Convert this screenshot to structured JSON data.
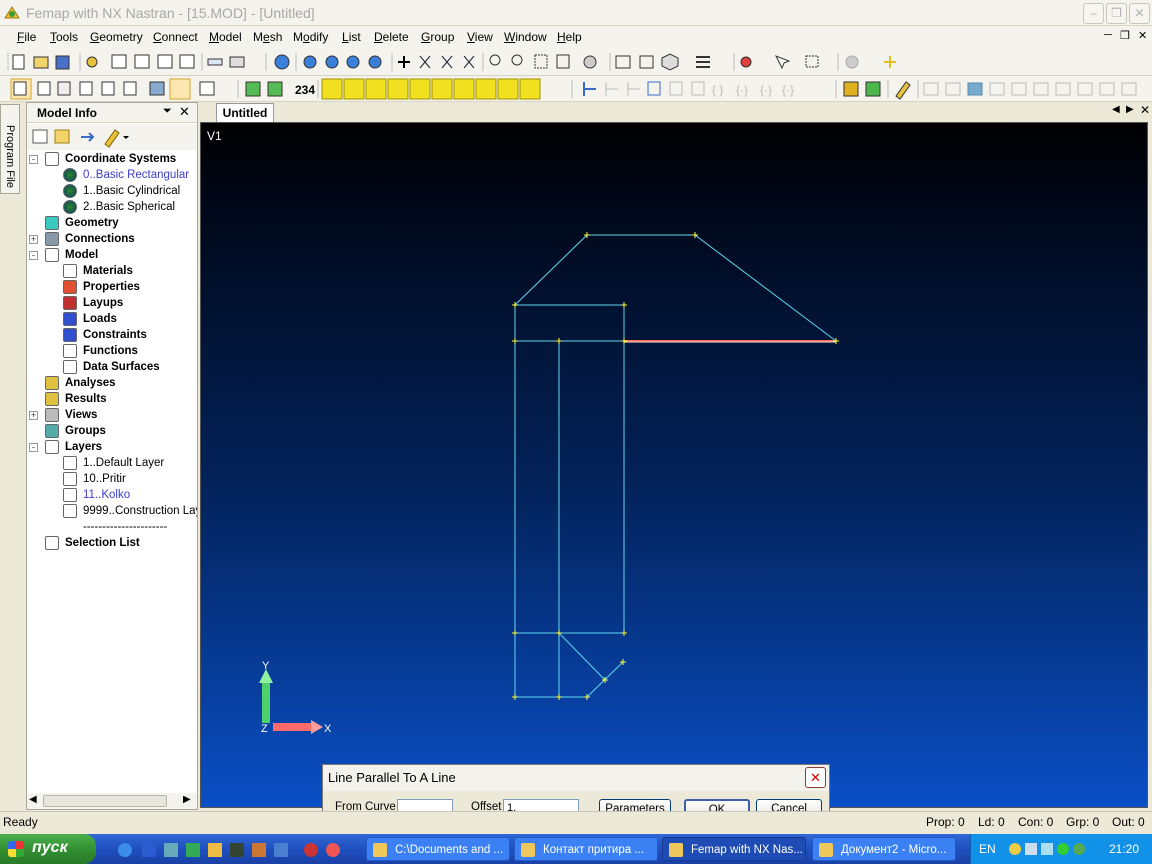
{
  "window": {
    "title": "Femap with NX Nastran - [15.MOD] - [Untitled]"
  },
  "menu": [
    {
      "pre": "",
      "u": "F",
      "post": "ile"
    },
    {
      "pre": "",
      "u": "T",
      "post": "ools"
    },
    {
      "pre": "",
      "u": "G",
      "post": "eometry"
    },
    {
      "pre": "",
      "u": "C",
      "post": "onnect"
    },
    {
      "pre": "",
      "u": "M",
      "post": "odel"
    },
    {
      "pre": "M",
      "u": "e",
      "post": "sh"
    },
    {
      "pre": "M",
      "u": "o",
      "post": "dify"
    },
    {
      "pre": "",
      "u": "L",
      "post": "ist"
    },
    {
      "pre": "",
      "u": "D",
      "post": "elete"
    },
    {
      "pre": "",
      "u": "G",
      "post": "roup"
    },
    {
      "pre": "",
      "u": "V",
      "post": "iew"
    },
    {
      "pre": "",
      "u": "W",
      "post": "indow"
    },
    {
      "pre": "",
      "u": "H",
      "post": "elp"
    }
  ],
  "toolbar": {
    "number_label": "234"
  },
  "sidetab": {
    "label": "Program File"
  },
  "panel": {
    "title": "Model Info",
    "tree": [
      {
        "label": "Coordinate Systems",
        "bold": true,
        "level": 0,
        "expander": "-",
        "icon": "coord-icon"
      },
      {
        "label": "0..Basic Rectangular",
        "bold": false,
        "blue": true,
        "level": 1,
        "icon": "globe-icon"
      },
      {
        "label": "1..Basic Cylindrical",
        "bold": false,
        "level": 1,
        "icon": "globe-icon"
      },
      {
        "label": "2..Basic Spherical",
        "bold": false,
        "level": 1,
        "icon": "globe-icon"
      },
      {
        "label": "Geometry",
        "bold": true,
        "level": 0,
        "icon": "cylinder-icon"
      },
      {
        "label": "Connections",
        "bold": true,
        "level": 0,
        "expander": "+",
        "icon": "connection-icon"
      },
      {
        "label": "Model",
        "bold": true,
        "level": 0,
        "expander": "-",
        "icon": "grid-icon"
      },
      {
        "label": "Materials",
        "bold": true,
        "level": 1,
        "icon": "materials-icon"
      },
      {
        "label": "Properties",
        "bold": true,
        "level": 1,
        "icon": "beam-icon"
      },
      {
        "label": "Layups",
        "bold": true,
        "level": 1,
        "icon": "layups-icon"
      },
      {
        "label": "Loads",
        "bold": true,
        "level": 1,
        "icon": "load-icon"
      },
      {
        "label": "Constraints",
        "bold": true,
        "level": 1,
        "icon": "constraint-icon"
      },
      {
        "label": "Functions",
        "bold": true,
        "level": 1,
        "icon": "function-icon"
      },
      {
        "label": "Data Surfaces",
        "bold": true,
        "level": 1,
        "icon": "data-surface-icon"
      },
      {
        "label": "Analyses",
        "bold": true,
        "level": 0,
        "icon": "analysis-icon"
      },
      {
        "label": "Results",
        "bold": true,
        "level": 0,
        "icon": "results-icon"
      },
      {
        "label": "Views",
        "bold": true,
        "level": 0,
        "expander": "+",
        "icon": "views-icon"
      },
      {
        "label": "Groups",
        "bold": true,
        "level": 0,
        "icon": "groups-icon"
      },
      {
        "label": "Layers",
        "bold": true,
        "level": 0,
        "expander": "-",
        "icon": "layers-icon"
      },
      {
        "label": "1..Default Layer",
        "bold": false,
        "level": 1,
        "icon": "layer-icon"
      },
      {
        "label": "10..Pritir",
        "bold": false,
        "level": 1,
        "icon": "layer-icon"
      },
      {
        "label": "11..Kolko",
        "bold": false,
        "blue": true,
        "level": 1,
        "icon": "layer-icon"
      },
      {
        "label": "9999..Construction Lay",
        "bold": false,
        "level": 1,
        "icon": "layer-icon"
      },
      {
        "label": "----------------------",
        "bold": false,
        "level": 1,
        "icon": ""
      },
      {
        "label": "Selection List",
        "bold": true,
        "level": 0,
        "icon": "cursor-icon"
      }
    ]
  },
  "viewport": {
    "tab": "Untitled",
    "view_label": "V1",
    "axis_y": "Y",
    "axis_x": "X",
    "axis_z": "Z"
  },
  "dialog": {
    "title": "Line Parallel To A Line",
    "from_curve_label_pre": "From C",
    "from_curve_label_u": "u",
    "from_curve_label_post": "rve",
    "from_curve_value": "",
    "offset_label": "Offset",
    "offset_value": "1,",
    "parameters_label": "Parameters",
    "ok_label": "OK",
    "cancel_label": "Cancel"
  },
  "status": {
    "left": "Ready",
    "prop": "Prop: 0",
    "ld": "Ld: 0",
    "con": "Con: 0",
    "grp": "Grp: 0",
    "out": "Out: 0"
  },
  "taskbar": {
    "start": "пуск",
    "tasks": [
      {
        "label": "C:\\Documents and ...",
        "active": false
      },
      {
        "label": "Контакт притира ...",
        "active": false
      },
      {
        "label": "Femap with NX Nas...",
        "active": true
      },
      {
        "label": "Документ2 - Micro...",
        "active": false
      }
    ],
    "lang": "EN",
    "time": "21:20"
  },
  "colors": {
    "geometry_line": "#5fd8f0",
    "highlight_line": "#ff6b5b",
    "point_marker": "#ffff40",
    "axis_y": "#4dd16b",
    "axis_x": "#ff6a6a"
  }
}
